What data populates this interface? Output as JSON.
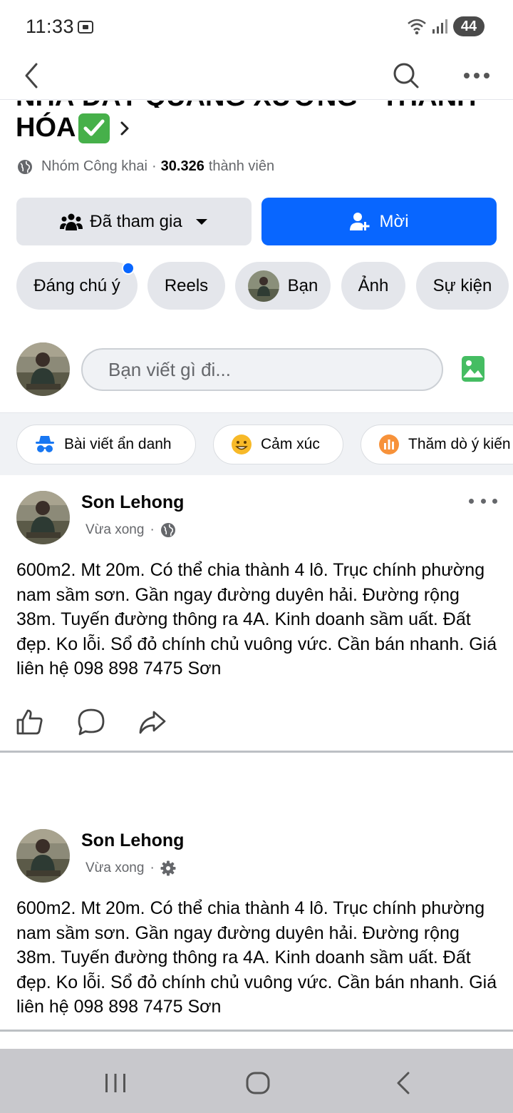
{
  "status_bar": {
    "time": "11:33",
    "battery": "44"
  },
  "group": {
    "title_partial": "NHÀ ĐẤT QUẢNG XƯƠNG - THANH",
    "title": "HÓA",
    "privacy": "Nhóm Công khai",
    "separator": "·",
    "member_count": "30.326",
    "member_label": "thành viên"
  },
  "buttons": {
    "joined": "Đã tham gia",
    "invite": "Mời"
  },
  "tabs": [
    {
      "label": "Đáng chú ý"
    },
    {
      "label": "Reels"
    },
    {
      "label": "Bạn"
    },
    {
      "label": "Ảnh"
    },
    {
      "label": "Sự kiện"
    }
  ],
  "composer": {
    "placeholder": "Bạn viết gì đi..."
  },
  "composer_actions": [
    {
      "label": "Bài viết ẩn danh"
    },
    {
      "label": "Cảm xúc"
    },
    {
      "label": "Thăm dò ý kiến"
    }
  ],
  "posts": [
    {
      "author": "Son Lehong",
      "time": "Vừa xong",
      "separator": "·",
      "text": "600m2. Mt 20m. Có thể chia thành 4 lô. Trục chính phường nam sầm sơn. Gần ngay đường duyên hải. Đường rộng 38m. Tuyến đường thông ra 4A. Kinh doanh sầm uất. Đất đẹp. Ko lỗi. Sổ đỏ chính chủ vuông vức. Cần bán nhanh. Giá liên hệ 098 898 7475 Sơn"
    },
    {
      "author": "Son Lehong",
      "time": "Vừa xong",
      "separator": "·",
      "text": "600m2. Mt 20m. Có thể chia thành 4 lô. Trục chính phường nam sầm sơn. Gần ngay đường duyên hải. Đường rộng 38m. Tuyến đường thông ra 4A. Kinh doanh sầm uất. Đất đẹp. Ko lỗi. Sổ đỏ chính chủ vuông vức. Cần bán nhanh. Giá liên hệ 098 898 7475 Sơn"
    }
  ],
  "icons": {
    "back": "back-arrow-icon",
    "search": "search-icon",
    "more": "more-dots-icon",
    "globe": "globe-icon",
    "people": "people-icon",
    "caret": "caret-down-icon",
    "add_person": "add-person-icon",
    "photo": "photo-icon",
    "incognito": "incognito-icon",
    "emoji": "smiley-icon",
    "poll": "poll-icon",
    "like": "like-icon",
    "comment": "comment-icon",
    "share": "share-icon",
    "gear": "gear-icon"
  },
  "colors": {
    "primary": "#0866ff",
    "chip_bg": "#e4e6eb",
    "muted_text": "#65676b",
    "check_green": "#46b04a"
  }
}
